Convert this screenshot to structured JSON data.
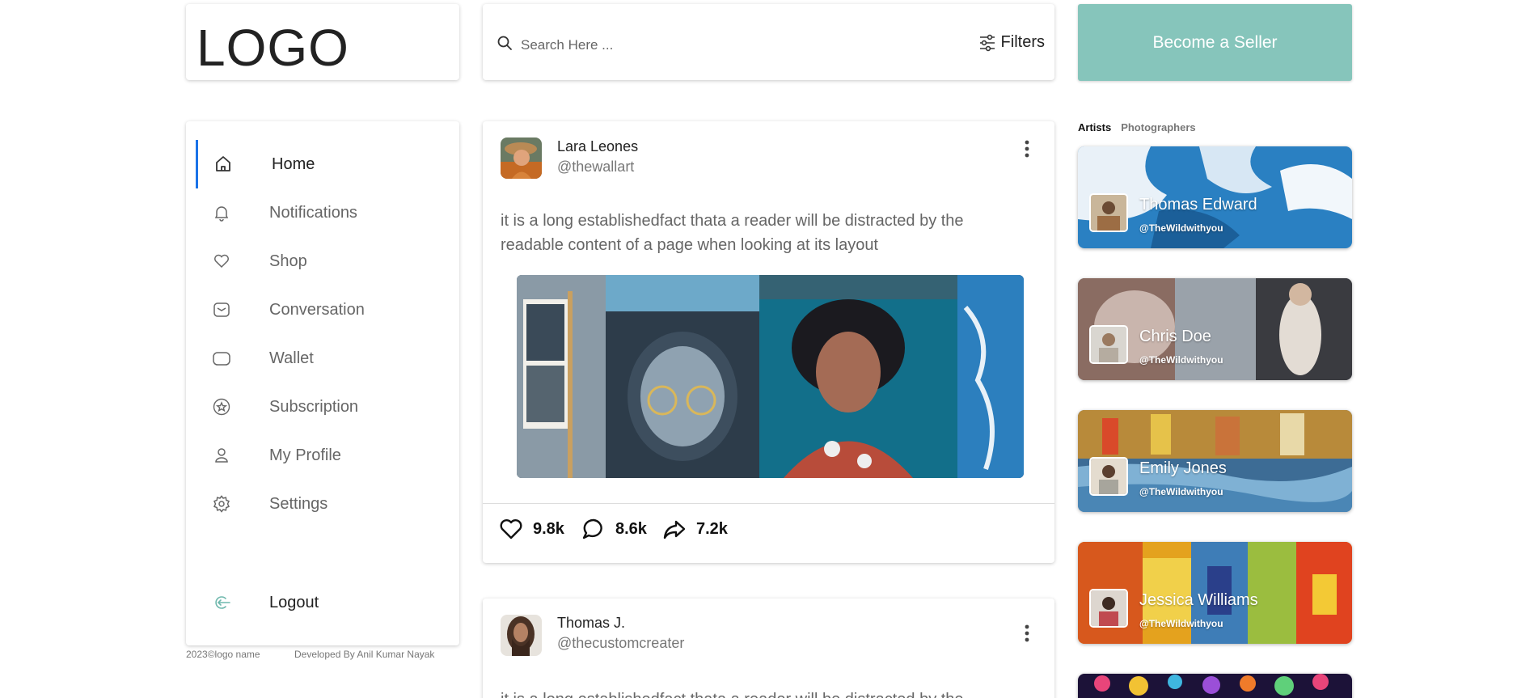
{
  "logo": {
    "text": "LOGO"
  },
  "search": {
    "placeholder": "Search Here ...",
    "filters_label": "Filters"
  },
  "seller": {
    "label": "Become a Seller"
  },
  "sidebar": {
    "items": [
      {
        "label": "Home",
        "icon": "home-icon",
        "active": true
      },
      {
        "label": "Notifications",
        "icon": "bell-icon"
      },
      {
        "label": "Shop",
        "icon": "heart-icon"
      },
      {
        "label": "Conversation",
        "icon": "mail-icon"
      },
      {
        "label": "Wallet",
        "icon": "wallet-icon"
      },
      {
        "label": "Subscription",
        "icon": "star-badge-icon"
      },
      {
        "label": "My Profile",
        "icon": "user-icon"
      },
      {
        "label": "Settings",
        "icon": "gear-icon"
      }
    ],
    "logout": {
      "label": "Logout",
      "icon": "logout-icon"
    },
    "accent": "#1a73e8"
  },
  "footer": {
    "copyright": "2023©logo name",
    "developer": "Developed By Anil Kumar Nayak"
  },
  "posts": [
    {
      "author": "Lara Leones",
      "handle": "@thewallart",
      "text": "it is a long establishedfact thata a reader will be distracted by the readable content of a page when looking at its layout",
      "likes": "9.8k",
      "comments": "8.6k",
      "shares": "7.2k"
    },
    {
      "author": "Thomas J.",
      "handle": "@thecustomcreater",
      "text": "it is a long establishedfact thata a reader will be distracted by the"
    }
  ],
  "right_panel": {
    "tabs": [
      "Artists",
      "Photographers"
    ],
    "artists": [
      {
        "name": "Thomas Edward",
        "handle": "@TheWildwithyou"
      },
      {
        "name": "Chris Doe",
        "handle": "@TheWildwithyou"
      },
      {
        "name": "Emily Jones",
        "handle": "@TheWildwithyou"
      },
      {
        "name": "Jessica Williams",
        "handle": "@TheWildwithyou"
      }
    ]
  },
  "colors": {
    "seller_bg": "#86c5bb",
    "logout_icon": "#6fb8ad"
  }
}
